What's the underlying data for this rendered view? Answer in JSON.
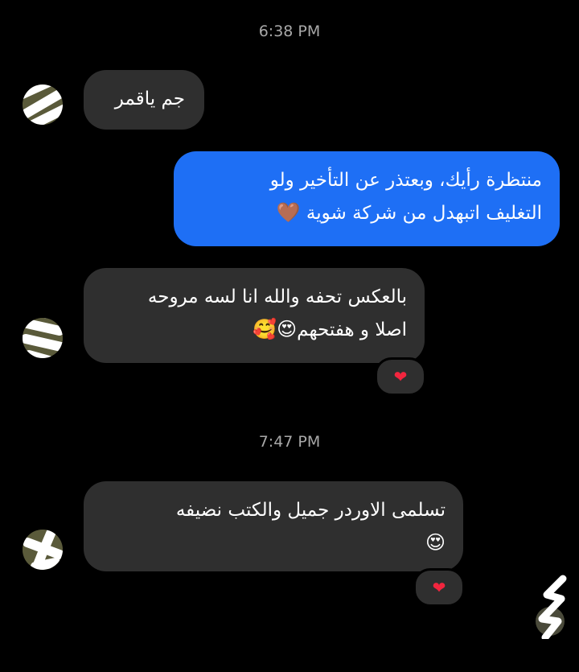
{
  "timestamps": [
    "6:38 PM",
    "7:47 PM"
  ],
  "messages": [
    {
      "direction": "incoming",
      "text": "جم ياقمر"
    },
    {
      "direction": "outgoing",
      "line1": "منتظرة رأيك، وبعتذر عن التأخير ولو",
      "line2": "التغليف اتبهدل من شركة شوية",
      "emoji": "🤎"
    },
    {
      "direction": "incoming",
      "line1": "بالعكس تحفه والله انا لسه مروحه",
      "line2": "اصلا و هفتحهم",
      "emoji": "😍🥰",
      "reaction": "❤"
    },
    {
      "direction": "incoming",
      "line1": "تسلمى الاوردر جميل والكتب نضيفه",
      "emoji": "😍",
      "reaction": "❤"
    }
  ],
  "icons": {
    "avatar": "contact-avatar-icon",
    "reaction": "heart-icon"
  },
  "colors": {
    "background": "#000000",
    "incoming_bubble": "#2f2f2f",
    "outgoing_bubble": "#1e6ff5",
    "timestamp": "#a8a8a8",
    "heart": "#f2253e"
  }
}
